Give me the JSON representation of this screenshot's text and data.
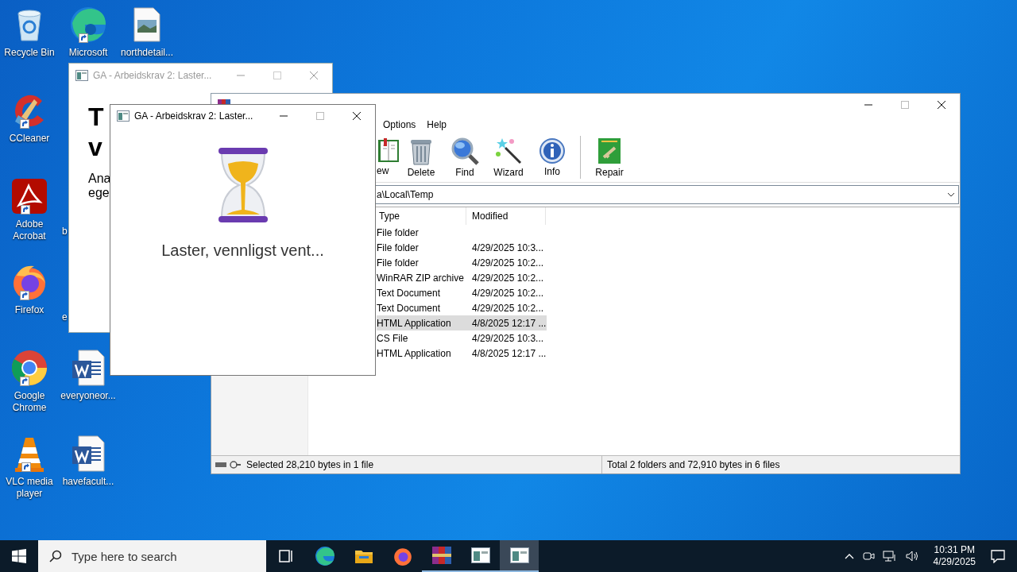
{
  "desktop_icons": [
    {
      "kind": "recycle",
      "label": "Recycle Bin",
      "shortcut": false
    },
    {
      "kind": "edge",
      "label": "Microsoft",
      "shortcut": true
    },
    {
      "kind": "image",
      "label": "northdetail...",
      "shortcut": false
    },
    {
      "kind": "ccleaner",
      "label": "CCleaner",
      "shortcut": true
    },
    {
      "kind": "acrobat",
      "label": "Adobe Acrobat",
      "shortcut": true
    },
    {
      "kind": "hidden",
      "label": "b"
    },
    {
      "kind": "firefox",
      "label": "Firefox",
      "shortcut": true
    },
    {
      "kind": "hidden",
      "label": "e"
    },
    {
      "kind": "chrome",
      "label": "Google Chrome",
      "shortcut": true
    },
    {
      "kind": "word",
      "label": "everyoneor...",
      "shortcut": false
    },
    {
      "kind": "vlc",
      "label": "VLC media player",
      "shortcut": true
    },
    {
      "kind": "word",
      "label": "havefacult...",
      "shortcut": false
    }
  ],
  "background_window": {
    "title": "GA - Arbeidskrav 2: Laster...",
    "active": false,
    "heading": [
      "T",
      "v"
    ],
    "paragraph": [
      "Ana",
      "ege"
    ]
  },
  "archive_window": {
    "menu": [
      "Options",
      "Help"
    ],
    "toolbar": [
      {
        "kind": "book",
        "label": "ew"
      },
      {
        "kind": "trash",
        "label": "Delete"
      },
      {
        "kind": "magnifier",
        "label": "Find"
      },
      {
        "kind": "wand",
        "label": "Wizard"
      },
      {
        "kind": "info",
        "label": "Info"
      },
      {
        "kind": "separator"
      },
      {
        "kind": "repair",
        "label": "Repair"
      }
    ],
    "path": "a\\Local\\Temp",
    "columns": [
      "Type",
      "Modified"
    ],
    "rows": [
      {
        "type": "File folder",
        "selected": false
      },
      {
        "type": "File folder",
        "modified": "4/29/2025 10:3...",
        "selected": false
      },
      {
        "type": "File folder",
        "modified": "4/29/2025 10:2...",
        "selected": false
      },
      {
        "type": "WinRAR ZIP archive",
        "modified": "4/29/2025 10:2...",
        "selected": false
      },
      {
        "type": "Text Document",
        "modified": "4/29/2025 10:2...",
        "selected": false
      },
      {
        "type": "Text Document",
        "modified": "4/29/2025 10:2...",
        "selected": false
      },
      {
        "type": "HTML Application",
        "modified": "4/8/2025 12:17 ...",
        "selected": true
      },
      {
        "type": "CS File",
        "modified": "4/29/2025 10:3...",
        "selected": false
      },
      {
        "type": "HTML Application",
        "modified": "4/8/2025 12:17 ...",
        "selected": false
      }
    ],
    "status_left": "Selected 28,210 bytes in 1 file",
    "status_right": "Total 2 folders and 72,910 bytes in 6 files"
  },
  "loading_window": {
    "title": "GA - Arbeidskrav 2: Laster...",
    "active": true,
    "message": "Laster, vennligst vent..."
  },
  "taskbar": {
    "search_placeholder": "Type here to search",
    "apps": [
      {
        "kind": "taskview",
        "running": false,
        "active": false
      },
      {
        "kind": "edge",
        "running": false,
        "active": false
      },
      {
        "kind": "explorer",
        "running": false,
        "active": false
      },
      {
        "kind": "firefox",
        "running": false,
        "active": false
      },
      {
        "kind": "winrar",
        "running": true,
        "active": false
      },
      {
        "kind": "app",
        "running": true,
        "active": false
      },
      {
        "kind": "app",
        "running": true,
        "active": true
      }
    ],
    "time": "10:31 PM",
    "date": "4/29/2025"
  }
}
